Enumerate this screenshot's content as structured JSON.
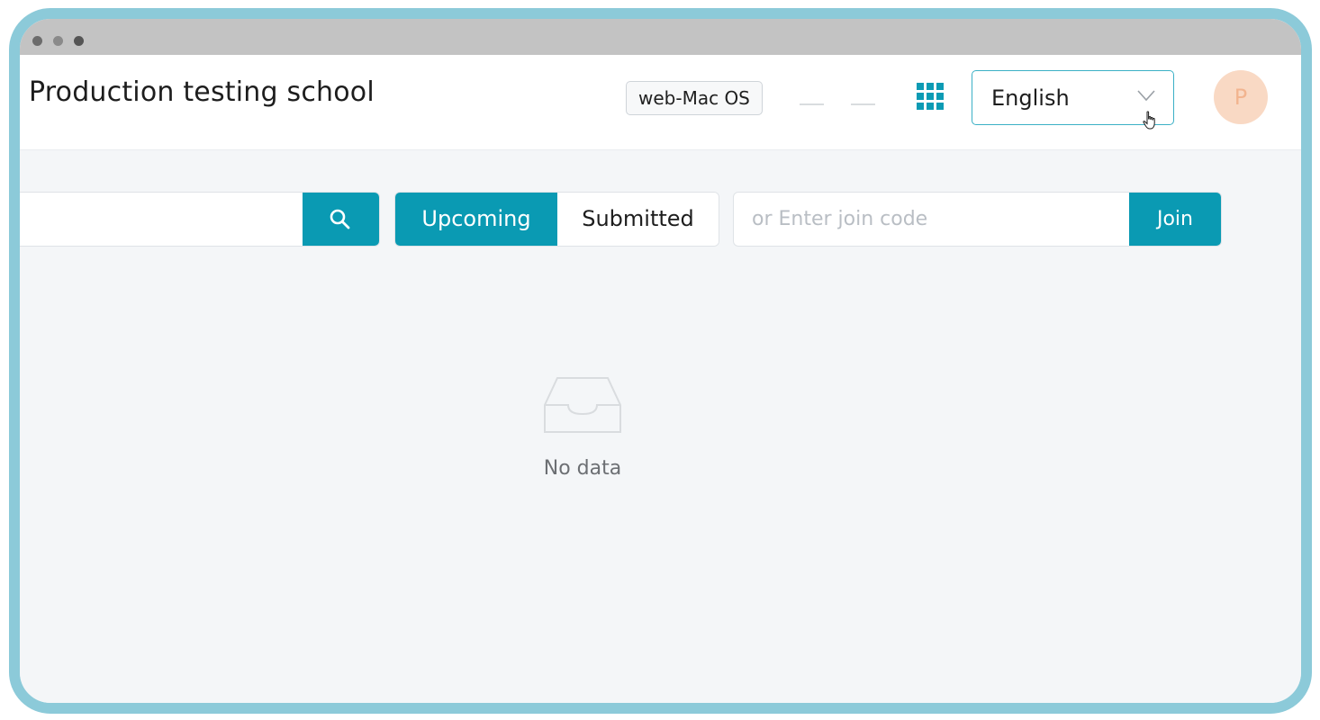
{
  "header": {
    "school_name": "Production testing school",
    "platform_tag": "web-Mac OS",
    "language": {
      "selected": "English"
    },
    "avatar_initial": "P"
  },
  "filters": {
    "search_placeholder": "",
    "tabs": [
      {
        "label": "Upcoming",
        "active": true
      },
      {
        "label": "Submitted",
        "active": false
      }
    ],
    "join": {
      "placeholder": "or Enter join code",
      "button_label": "Join"
    }
  },
  "empty_state": {
    "message": "No data"
  },
  "colors": {
    "accent": "#0a9ab3",
    "frame": "#8ccad9",
    "avatar_bg": "#f9d9c4"
  },
  "icons": [
    "apps-grid-icon",
    "chevron-down-icon",
    "search-icon",
    "empty-inbox-icon",
    "pointer-cursor-icon"
  ]
}
